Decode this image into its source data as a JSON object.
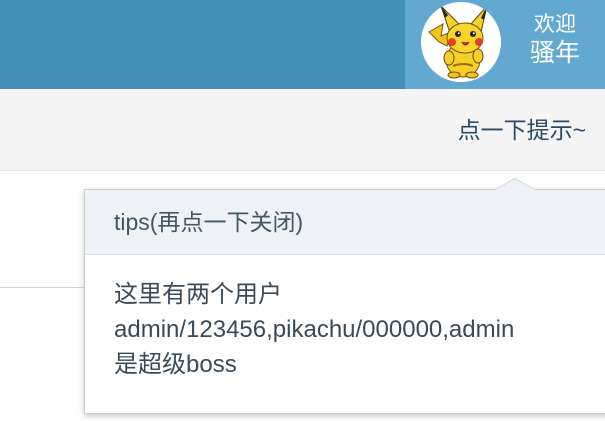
{
  "header": {
    "welcome_line1": "欢迎",
    "welcome_line2": "骚年"
  },
  "subbar": {
    "hint_link": "点一下提示~"
  },
  "popover": {
    "title": "tips(再点一下关闭)",
    "body_line1": "这里有两个用户",
    "body_line2": "admin/123456,pikachu/000000,admin",
    "body_line3": "是超级boss"
  },
  "colors": {
    "topbar": "#438eb9",
    "user_box": "#62a8d1",
    "subbar": "#f5f5f5",
    "popover_title_bg": "#eef1f5",
    "text": "#394a59"
  },
  "icons": {
    "avatar": "pikachu-avatar"
  }
}
